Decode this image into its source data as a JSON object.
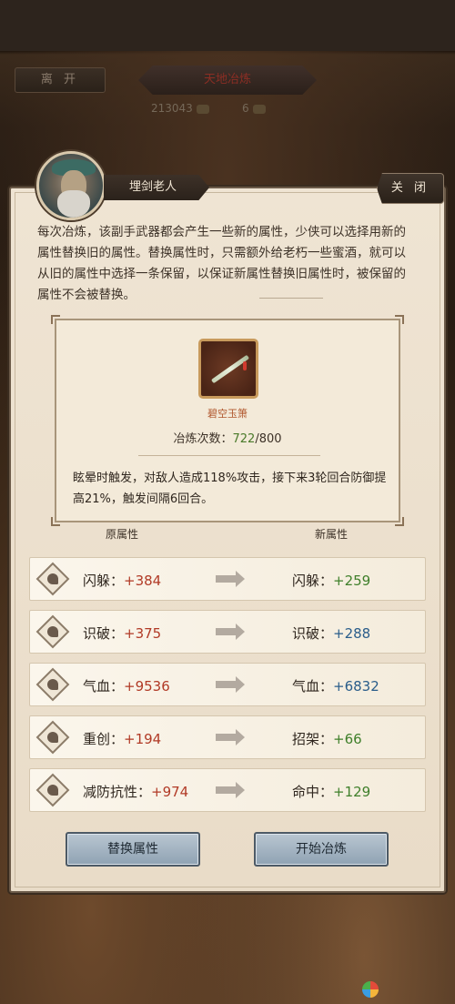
{
  "header": {
    "leave_label": "离 开",
    "title": "天地冶炼",
    "coins": "213043",
    "gems": "6"
  },
  "npc": {
    "name": "埋剑老人",
    "close_label": "关 闭"
  },
  "description": "每次冶炼，该副手武器都会产生一些新的属性，少侠可以选择用新的属性替换旧的属性。替换属性时，只需额外给老朽一些蜜酒，就可以从旧的属性中选择一条保留，以保证新属性替换旧属性时，被保留的属性不会被替换。",
  "item": {
    "name": "碧空玉箫",
    "refine_label": "冶炼次数：",
    "refine_current": "722",
    "refine_max": "/800",
    "effect": "眩晕时触发，对敌人造成118%攻击，接下来3轮回合防御提高21%，触发间隔6回合。"
  },
  "columns": {
    "old": "原属性",
    "new": "新属性"
  },
  "attributes": [
    {
      "old_name": "闪躲：",
      "old_value": "+384",
      "new_name": "闪躲：",
      "new_value": "+259"
    },
    {
      "old_name": "识破：",
      "old_value": "+375",
      "new_name": "识破：",
      "new_value": "+288"
    },
    {
      "old_name": "气血：",
      "old_value": "+9536",
      "new_name": "气血：",
      "new_value": "+6832"
    },
    {
      "old_name": "重创：",
      "old_value": "+194",
      "new_name": "招架：",
      "new_value": "+66"
    },
    {
      "old_name": "减防抗性：",
      "old_value": "+974",
      "new_name": "命中：",
      "new_value": "+129"
    }
  ],
  "buttons": {
    "replace": "替换属性",
    "start": "开始冶炼"
  },
  "colors": {
    "old_value": "#b13a26",
    "new_value_green": "#3f7f2a",
    "new_value_blue": "#2a5d8a",
    "item_name": "#b0562c",
    "button_bg": "#8fa2b3"
  }
}
